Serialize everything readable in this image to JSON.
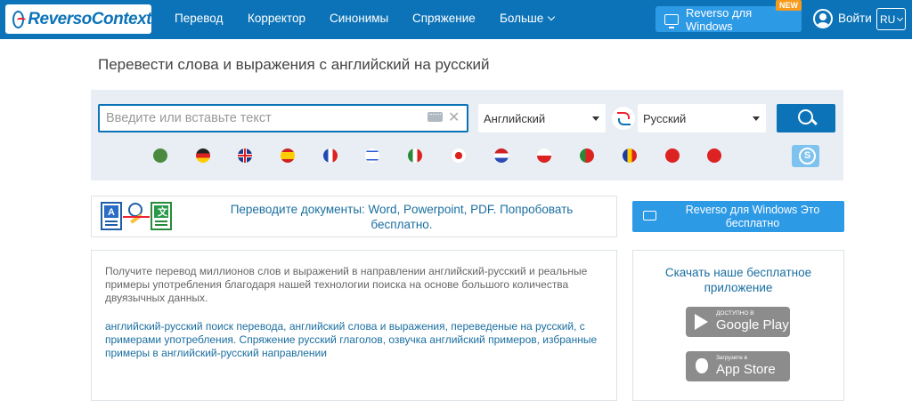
{
  "header": {
    "logo": "ReversoContext",
    "nav": [
      "Перевод",
      "Корректор",
      "Синонимы",
      "Спряжение",
      "Больше"
    ],
    "windows_button": "Reverso для Windows",
    "new_badge": "NEW",
    "login": "Войти",
    "lang": "RU"
  },
  "main": {
    "title": "Перевести слова и выражения с английский на русский",
    "search_placeholder": "Введите или вставьте текст",
    "source_lang": "Английский",
    "target_lang": "Русский",
    "flags": [
      "ar",
      "de",
      "en",
      "es",
      "fr",
      "he",
      "it",
      "ja",
      "nl",
      "pl",
      "pt",
      "ro",
      "tr",
      "zh"
    ]
  },
  "banners": {
    "documents": "Переводите документы: Word, Powerpoint, PDF. Попробовать бесплатно.",
    "windows": "Reverso для Windows Это бесплатно"
  },
  "description": {
    "text1": "Получите перевод миллионов слов и выражений в направлении английский-русский и реальные примеры употребления благодаря нашей технологии поиска на основе большого количества двуязычных данных.",
    "text2": "английский-русский поиск перевода, английский слова и выражения, переведеные на русский, с примерами употребления. Спряжение русский глаголов, озвучка английский примеров, избранные примеры в английский-русский направлении"
  },
  "app": {
    "title": "Скачать наше бесплатное приложение",
    "google_small": "ДОСТУПНО В",
    "google_big": "Google Play",
    "apple_small": "Загрузите в",
    "apple_big": "App Store"
  },
  "colors": {
    "brand": "#0c73b8",
    "accent": "#2d9ae6",
    "badge": "#f89b1c"
  }
}
